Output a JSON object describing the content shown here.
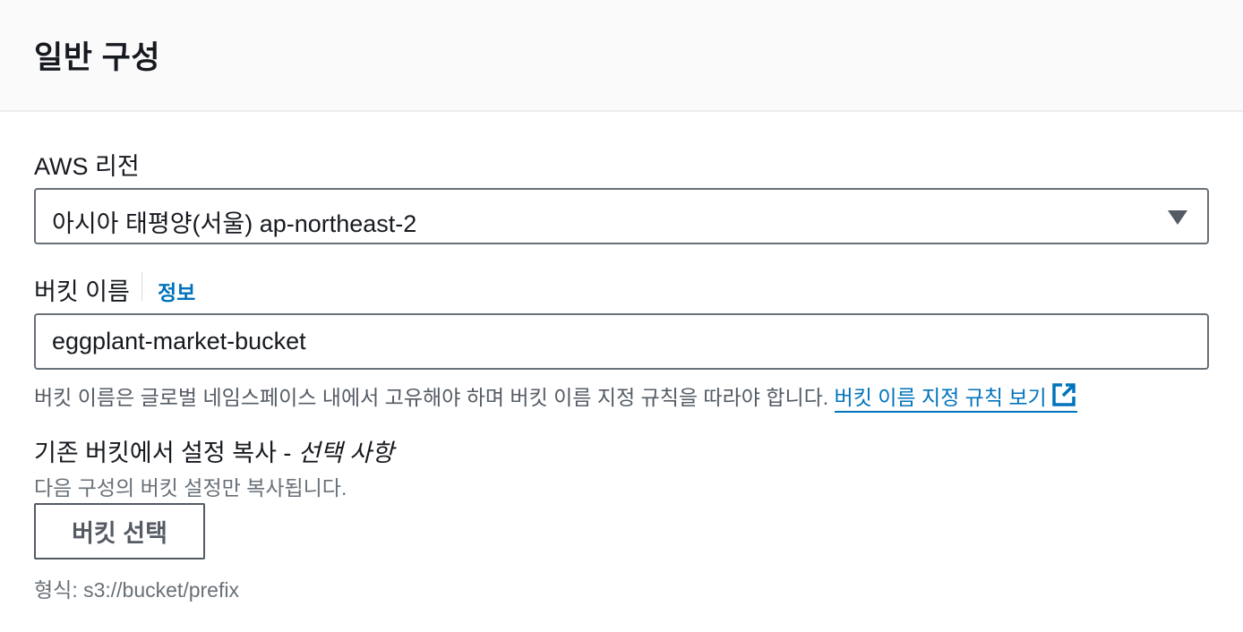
{
  "panel": {
    "title": "일반 구성"
  },
  "region": {
    "label": "AWS 리전",
    "selected": "아시아 태평양(서울) ap-northeast-2",
    "icon": "caret-down-icon"
  },
  "bucket_name": {
    "label": "버킷 이름",
    "info_link": "정보",
    "value": "eggplant-market-bucket",
    "constraint_text": "버킷 이름은 글로벌 네임스페이스 내에서 고유해야 하며 버킷 이름 지정 규칙을 따라야 합니다.",
    "rules_link": "버킷 이름 지정 규칙 보기",
    "rules_icon": "external-link-icon"
  },
  "copy_settings": {
    "label": "기존 버킷에서 설정 복사 -",
    "optional": "선택 사항",
    "description": "다음 구성의 버킷 설정만 복사됩니다.",
    "button_label": "버킷 선택",
    "format_hint": "형식: s3://bucket/prefix"
  },
  "colors": {
    "link": "#0073bb",
    "text": "#16191f",
    "secondary_text": "#687078",
    "border": "#687078",
    "header_bg": "#fafafa"
  }
}
